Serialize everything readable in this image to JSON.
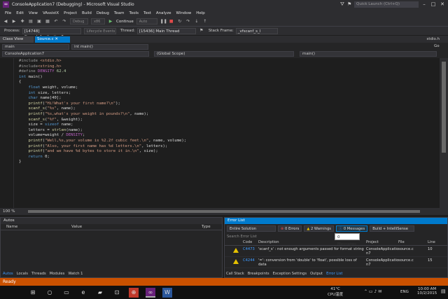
{
  "window": {
    "title": "ConsoleApplication7 (Debugging) - Microsoft Visual Studio",
    "quick_launch": "Quick Launch (Ctrl+Q)"
  },
  "menu": [
    "File",
    "Edit",
    "View",
    "VAssistX",
    "Project",
    "Build",
    "Debug",
    "Team",
    "Tools",
    "Test",
    "Analyze",
    "Window",
    "Help"
  ],
  "toolbar": {
    "debug_config": "Debug",
    "platform": "x86",
    "continue_label": "Continue",
    "auto_label": "Auto",
    "lifecycle_label": "Lifecycle Events"
  },
  "process_bar": {
    "process_label": "Process:",
    "process_value": "[14748] ConsoleApplication7.exe",
    "thread_label": "Thread:",
    "thread_value": "[15436] Main Thread",
    "stackframe_label": "Stack Frame:",
    "stackframe_value": "_vfscanf_s_l"
  },
  "tabs": {
    "class_view": "Class View",
    "file_tab": "Source.c",
    "right_file": "stdio.h"
  },
  "nav": {
    "solution": "ConsoleApplication7",
    "scope": "(Global Scope)",
    "member": "main()",
    "left_dropdown": "main",
    "mid_dropdown": "int main()",
    "go": "Go"
  },
  "code_lines": [
    "#include <stdio.h>",
    "#include<string.h>",
    "#define DENSITY 62.4",
    "int main()",
    "{",
    "    float weight, volume;",
    "    int size, letters;",
    "    char name[40];",
    "    printf(\"Hi!What's your first name?\\n\");",
    "    scanf_s(\"%s\", name);",
    "    printf(\"%s,what's your weight in pounds?\\n\", name);",
    "    scanf_s(\"%f\", &weight);",
    "    size = sizeof name;",
    "    letters = strlen(name);",
    "    volume=weight / DENSITY;",
    "    printf(\"Well,%s,your volume is %2.2f cubic feet.\\n\", name, volume);",
    "    printf(\"Also, your first name has %d letters.\\n\", letters);",
    "    printf(\"and we have %d bytes to store it in.\\n\", size);",
    "    return 0;",
    "}"
  ],
  "zoom": "100 %",
  "autos": {
    "title": "Autos",
    "col_name": "Name",
    "col_value": "Value",
    "col_type": "Type",
    "bottom_tabs": [
      "Autos",
      "Locals",
      "Threads",
      "Modules",
      "Watch 1"
    ]
  },
  "error_list": {
    "title": "Error List",
    "scope": "Entire Solution",
    "errors": "0 Errors",
    "warnings": "2 Warnings",
    "messages": "0 Messages",
    "build_filter": "Build + IntelliSense",
    "tooltip": "0 Messages",
    "search": "Search Error List",
    "headers": [
      "Code",
      "Description",
      "Project",
      "File",
      "Line"
    ],
    "rows": [
      {
        "code": "C4473",
        "description": "'scanf_s' : not enough arguments passed for format string",
        "project": "ConsoleApplicatio n7",
        "file": "source.c",
        "line": "10"
      },
      {
        "code": "C4244",
        "description": "'=': conversion from 'double' to 'float', possible loss of data",
        "project": "ConsoleApplicatio n7",
        "file": "source.c",
        "line": "15"
      }
    ],
    "bottom_tabs": [
      "Call Stack",
      "Breakpoints",
      "Exception Settings",
      "Output",
      "Error List"
    ]
  },
  "status": "Ready",
  "taskbar": {
    "weather": "41°C",
    "weather_sub": "CPU温度",
    "lang": "ENG",
    "time": "10:00 AM",
    "date": "10/2/2015"
  },
  "colors": {
    "accent": "#007acc",
    "status": "#ca5100",
    "vs_purple": "#68217a"
  }
}
